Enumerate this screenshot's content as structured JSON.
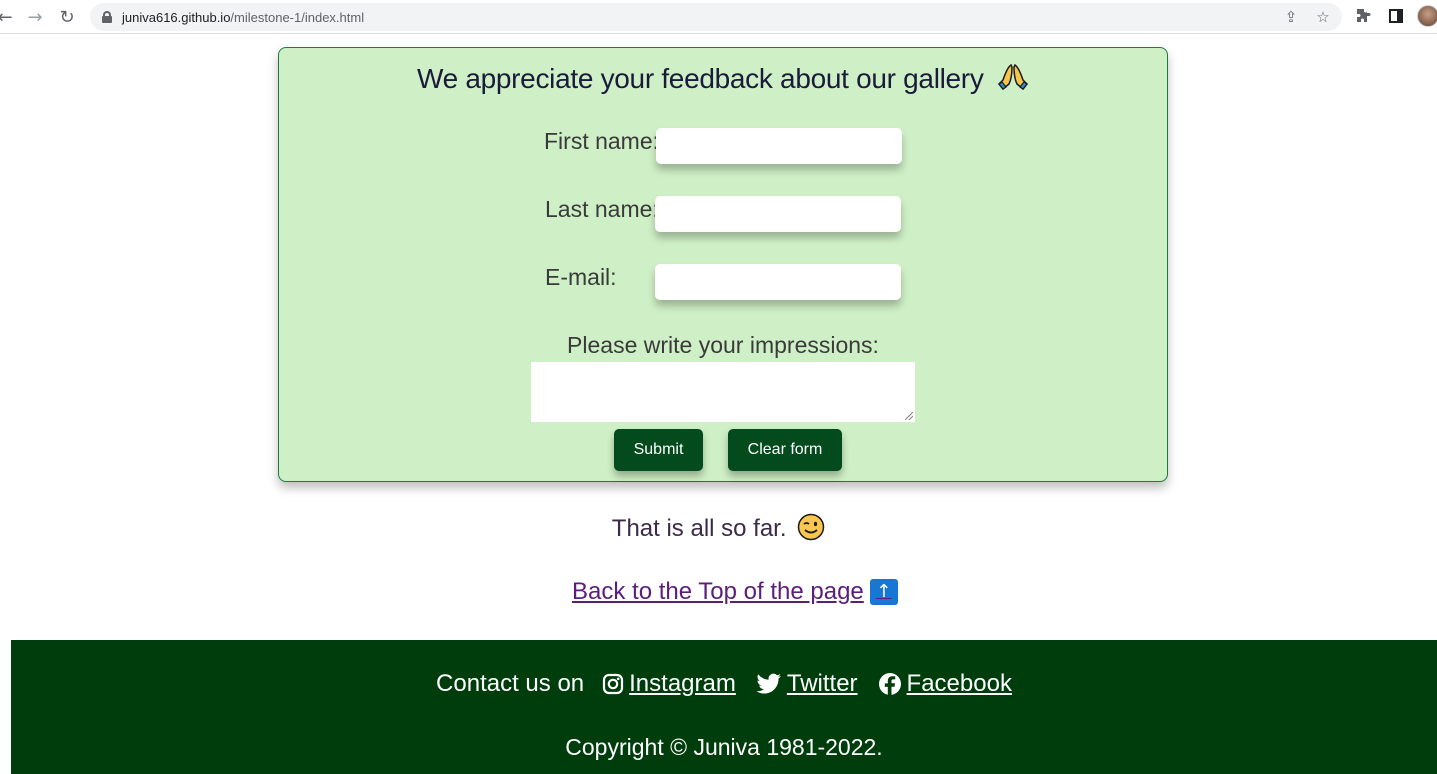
{
  "browser": {
    "url_host": "juniva616.github.io",
    "url_path": "/milestone-1/index.html"
  },
  "feedback": {
    "title": "We appreciate your feedback about our gallery",
    "first_name_label": "First name:",
    "last_name_label": "Last name:",
    "email_label": "E-mail:",
    "impressions_label": "Please write your impressions:",
    "first_name_value": "",
    "last_name_value": "",
    "email_value": "",
    "impressions_value": "",
    "submit_label": "Submit",
    "clear_label": "Clear form",
    "card_bg": "#cff0c6",
    "button_bg": "#034a1c"
  },
  "closing": {
    "text": "That is all so far.",
    "back_top_link": "Back to the Top of the page"
  },
  "footer": {
    "contact_label": "Contact us on",
    "links": [
      {
        "label": "Instagram",
        "icon": "instagram-icon"
      },
      {
        "label": "Twitter",
        "icon": "twitter-icon"
      },
      {
        "label": "Facebook",
        "icon": "facebook-icon"
      }
    ],
    "copyright": "Copyright © Juniva 1981-2022.",
    "bg": "#003d0c"
  }
}
